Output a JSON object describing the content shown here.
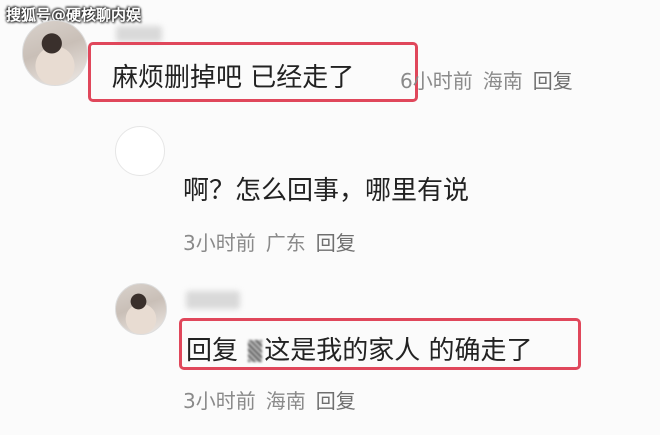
{
  "watermark": "搜狐号@硬核聊内娱",
  "comments": [
    {
      "text": "麻烦删掉吧 已经走了",
      "time": "6小时前",
      "location": "海南",
      "reply_label": "回复"
    },
    {
      "text": "啊？怎么回事，哪里有说",
      "time": "3小时前",
      "location": "广东",
      "reply_label": "回复"
    },
    {
      "text_prefix": "回复",
      "text_body": "这是我的家人 的确走了",
      "time": "3小时前",
      "location": "海南",
      "reply_label": "回复"
    }
  ],
  "colors": {
    "highlight": "#e0475b",
    "text": "#222222",
    "meta": "#8a8a8a"
  }
}
